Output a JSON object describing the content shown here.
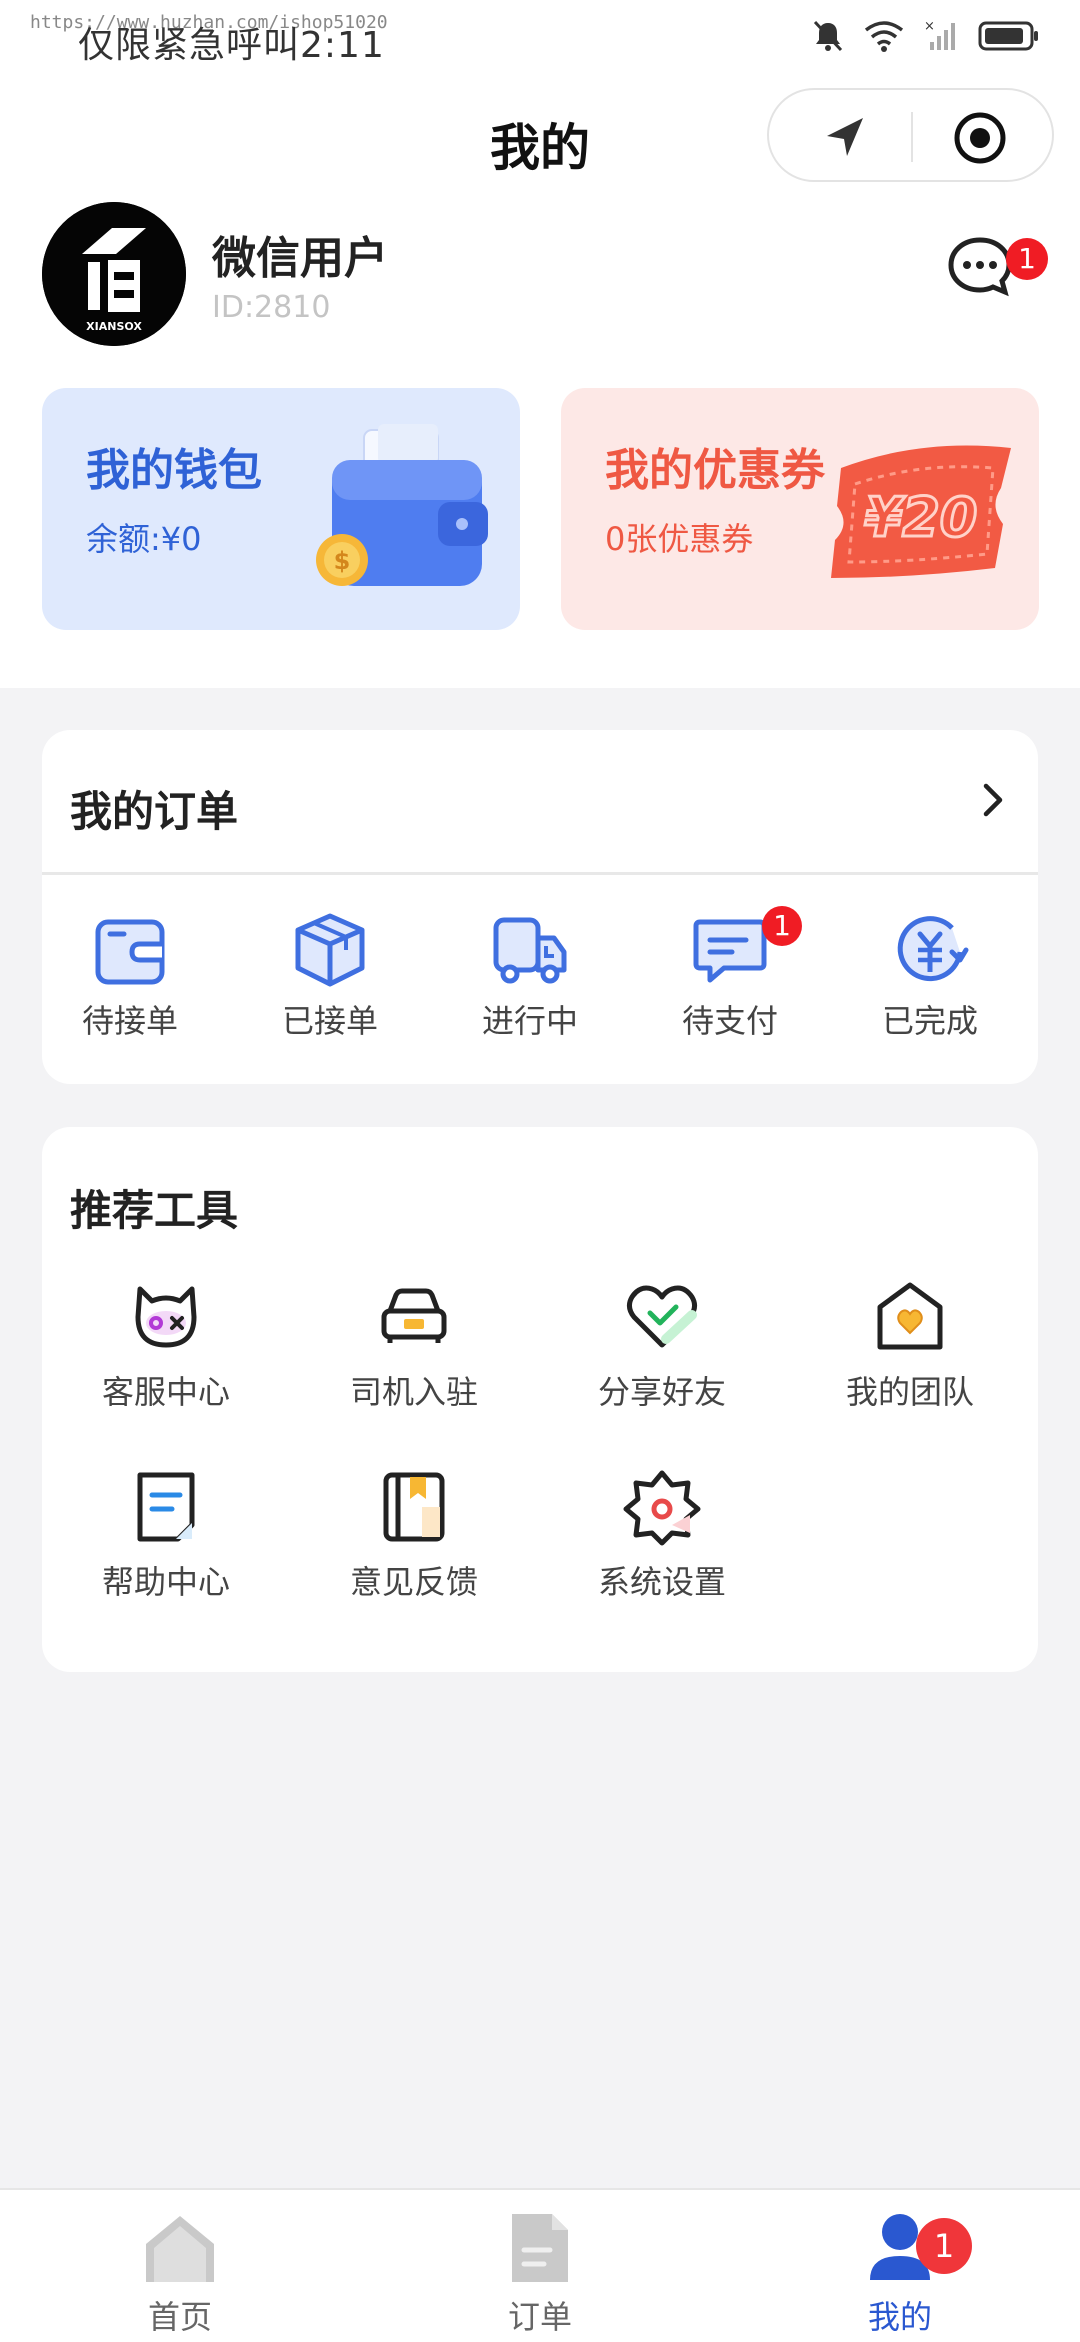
{
  "status_bar": {
    "carrier_time": "仅限紧急呼叫2:11",
    "url_text": "https://www.huzhan.com/ishop51020"
  },
  "header": {
    "title": "我的"
  },
  "profile": {
    "name": "微信用户",
    "id_text": "ID:2810",
    "avatar_brand": "XIANSOX",
    "message_badge": "1"
  },
  "wallet": {
    "title": "我的钱包",
    "balance": "余额:¥0"
  },
  "coupon": {
    "title": "我的优惠券",
    "count": "0张优惠券",
    "ticket_text": "¥20"
  },
  "orders": {
    "title": "我的订单",
    "items": [
      {
        "label": "待接单",
        "icon": "wallet-icon"
      },
      {
        "label": "已接单",
        "icon": "box-icon"
      },
      {
        "label": "进行中",
        "icon": "truck-icon"
      },
      {
        "label": "待支付",
        "icon": "message-icon",
        "badge": "1"
      },
      {
        "label": "已完成",
        "icon": "yuan-icon"
      }
    ]
  },
  "tools": {
    "title": "推荐工具",
    "items": [
      {
        "label": "客服中心",
        "icon": "customer-service-icon"
      },
      {
        "label": "司机入驻",
        "icon": "car-icon"
      },
      {
        "label": "分享好友",
        "icon": "heart-check-icon"
      },
      {
        "label": "我的团队",
        "icon": "team-house-icon"
      },
      {
        "label": "帮助中心",
        "icon": "help-doc-icon"
      },
      {
        "label": "意见反馈",
        "icon": "feedback-book-icon"
      },
      {
        "label": "系统设置",
        "icon": "settings-gear-icon"
      }
    ]
  },
  "tab_bar": {
    "items": [
      {
        "label": "首页",
        "icon": "home-icon",
        "active": false
      },
      {
        "label": "订单",
        "icon": "order-doc-icon",
        "active": false
      },
      {
        "label": "我的",
        "icon": "user-icon",
        "active": true,
        "badge": "1"
      }
    ]
  },
  "colors": {
    "accent_blue": "#2f62d6",
    "accent_red": "#ef5843",
    "badge_red": "#f01c24",
    "page_bg": "#f3f3f5"
  }
}
